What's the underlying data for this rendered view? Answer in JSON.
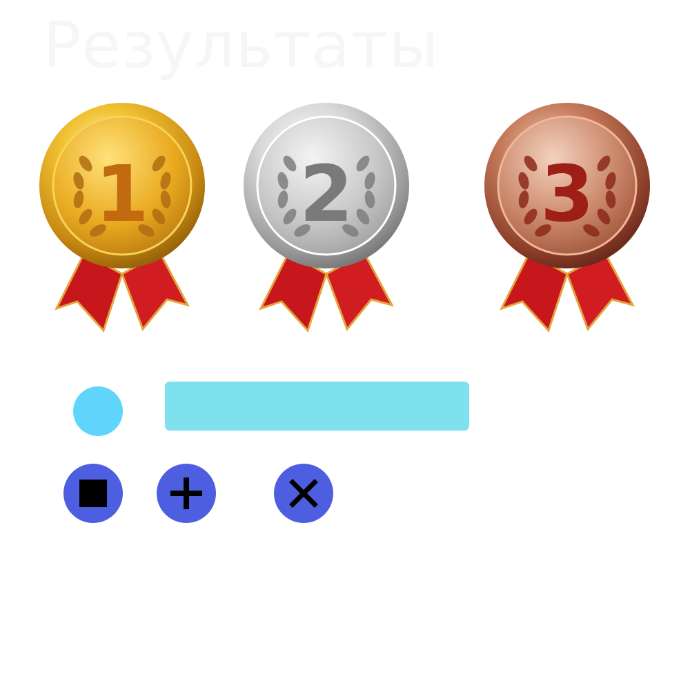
{
  "header": {
    "title": "Результаты"
  },
  "medals": [
    {
      "place": "1",
      "metal": "gold",
      "color": "#e0a51c"
    },
    {
      "place": "2",
      "metal": "silver",
      "color": "#c9c9c9"
    },
    {
      "place": "3",
      "metal": "bronze",
      "color": "#a8533b"
    }
  ],
  "ribbon_color": "#c8161d",
  "controls": {
    "radio_color": "#5fd5fb",
    "input_color": "#7fe0ee",
    "button_color": "#4d5fe0",
    "buttons": [
      {
        "icon": "stop-icon"
      },
      {
        "icon": "plus-icon"
      },
      {
        "icon": "close-icon"
      }
    ]
  }
}
